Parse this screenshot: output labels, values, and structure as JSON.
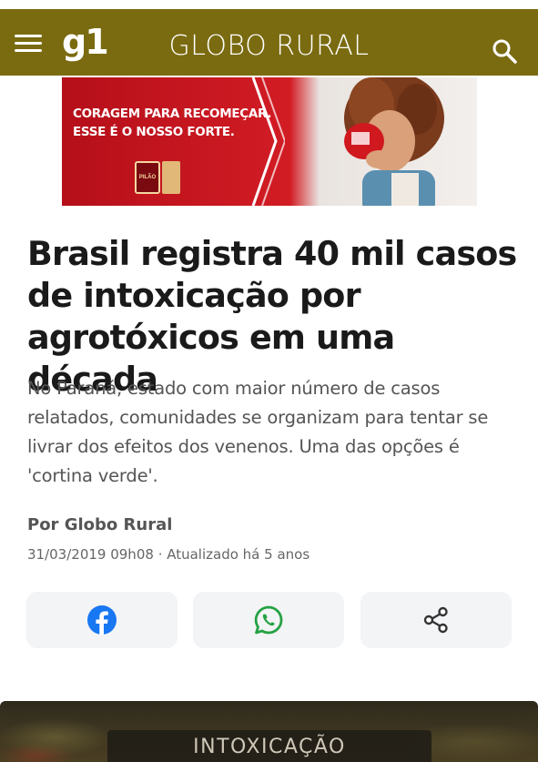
{
  "header": {
    "logo": "g1",
    "section": "GLOBO RURAL",
    "background": "#7a6b10"
  },
  "ad": {
    "line1": "CORAGEM PARA RECOMEÇAR.",
    "line2": "ESSE É O NOSSO FORTE.",
    "brand": "PILÃO",
    "colors": {
      "red": "#c8141c",
      "cream": "#f3efec"
    }
  },
  "article": {
    "headline": "Brasil registra 40 mil casos de intoxicação por agrotóxicos em uma década",
    "summary": "No Paraná, estado com maior número de casos relatados, comunidades se organizam para tentar se livrar dos efeitos dos venenos. Uma das opções é 'cortina verde'.",
    "author": "Por Globo Rural",
    "published": "31/03/2019 09h08",
    "updated": "Atualizado há 5 anos"
  },
  "share": {
    "facebook_icon": "facebook-icon",
    "whatsapp_icon": "whatsapp-icon",
    "share_icon": "share-icon",
    "colors": {
      "facebook": "#1877f2",
      "whatsapp": "#25a244",
      "share": "#333333"
    }
  },
  "image": {
    "tag": "INTOXICAÇÃO"
  }
}
